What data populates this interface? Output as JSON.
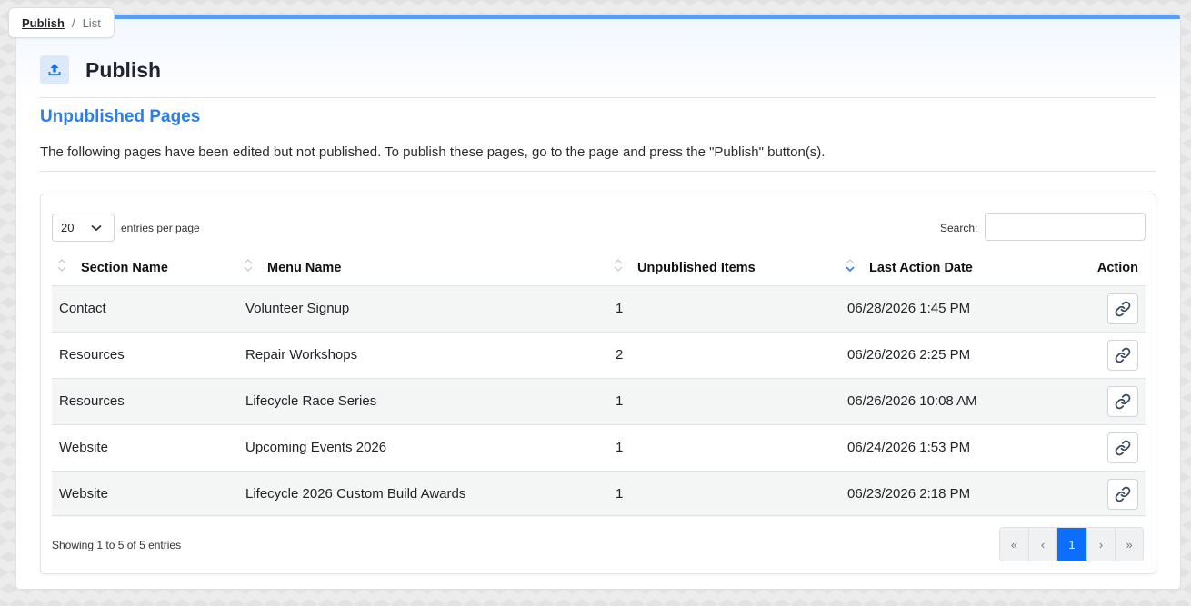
{
  "breadcrumb": {
    "parent": "Publish",
    "separator": "/",
    "current": "List"
  },
  "header": {
    "title": "Publish",
    "icon": "upload-icon"
  },
  "section": {
    "heading": "Unpublished Pages",
    "description": "The following pages have been edited but not published. To publish these pages, go to the page and press the \"Publish\" button(s)."
  },
  "controls": {
    "per_page_value": "20",
    "per_page_label": "entries per page",
    "search_label": "Search:",
    "search_value": ""
  },
  "table": {
    "columns": [
      "Section Name",
      "Menu Name",
      "Unpublished Items",
      "Last Action Date",
      "Action"
    ],
    "sorted_column": "Last Action Date",
    "sort_direction": "descending",
    "rows": [
      {
        "section": "Contact",
        "menu": "Volunteer Signup",
        "items": "1",
        "date": "06/28/2026 1:45 PM"
      },
      {
        "section": "Resources",
        "menu": "Repair Workshops",
        "items": "2",
        "date": "06/26/2026 2:25 PM"
      },
      {
        "section": "Resources",
        "menu": "Lifecycle Race Series",
        "items": "1",
        "date": "06/26/2026 10:08 AM"
      },
      {
        "section": "Website",
        "menu": "Upcoming Events 2026",
        "items": "1",
        "date": "06/24/2026 1:53 PM"
      },
      {
        "section": "Website",
        "menu": "Lifecycle 2026 Custom Build Awards",
        "items": "1",
        "date": "06/23/2026 2:18 PM"
      }
    ]
  },
  "footer": {
    "info": "Showing 1 to 5 of 5 entries",
    "pages": [
      "«",
      "‹",
      "1",
      "›",
      "»"
    ],
    "active_page": "1"
  },
  "colors": {
    "accent": "#2b7de9",
    "top_border": "#5b9cf5",
    "active_page": "#0d6efd"
  }
}
